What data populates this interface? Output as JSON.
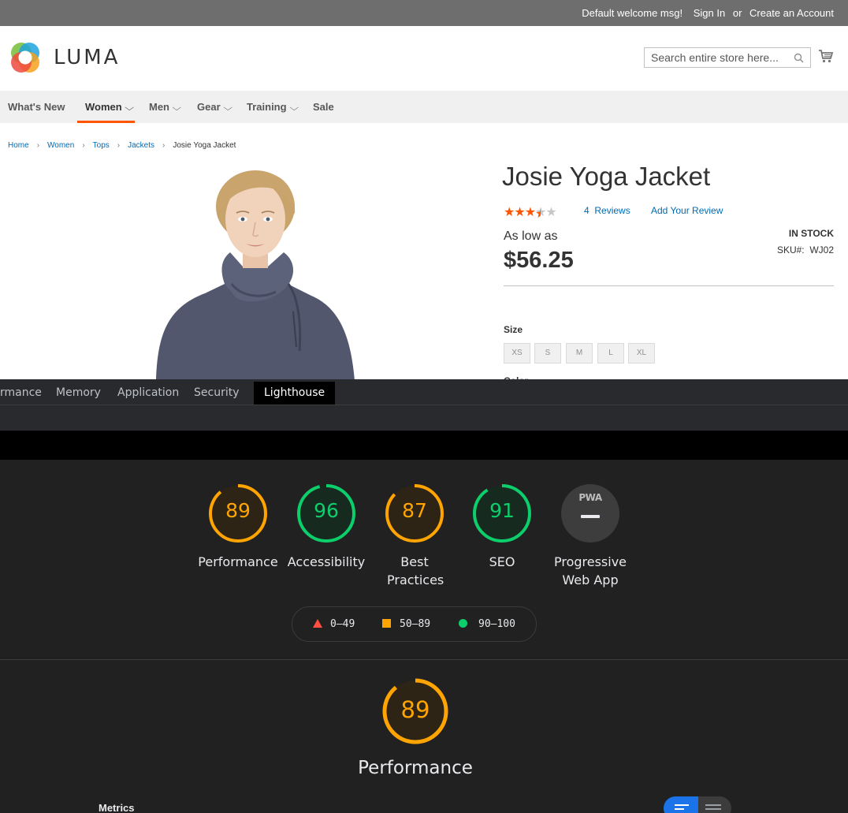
{
  "topbar": {
    "welcome": "Default welcome msg!",
    "sign_in": "Sign In",
    "or": "or",
    "create_account": "Create an Account"
  },
  "header": {
    "logo_text": "LUMA",
    "search_placeholder": "Search entire store here...",
    "icons": [
      "search-icon",
      "cart-icon"
    ]
  },
  "nav": {
    "items": [
      {
        "label": "What's New",
        "has_chevron": false
      },
      {
        "label": "Women",
        "has_chevron": true,
        "active": true
      },
      {
        "label": "Men",
        "has_chevron": true
      },
      {
        "label": "Gear",
        "has_chevron": true
      },
      {
        "label": "Training",
        "has_chevron": true
      },
      {
        "label": "Sale",
        "has_chevron": false
      }
    ],
    "active_color": "#ff5501"
  },
  "breadcrumbs": [
    "Home",
    "Women",
    "Tops",
    "Jackets",
    "Josie Yoga Jacket"
  ],
  "product": {
    "title": "Josie Yoga Jacket",
    "rating": 3.5,
    "rating_max": 5,
    "reviews_count": "4",
    "reviews_label": "Reviews",
    "add_review": "Add Your Review",
    "as_low_as": "As low as",
    "price": "$56.25",
    "stock": "IN STOCK",
    "sku_label": "SKU#:",
    "sku": "WJ02",
    "size_label": "Size",
    "sizes": [
      "XS",
      "S",
      "M",
      "L",
      "XL"
    ],
    "color_label": "Color"
  },
  "devtools": {
    "tabs": [
      {
        "label": "rmance"
      },
      {
        "label": "Memory"
      },
      {
        "label": "Application"
      },
      {
        "label": "Security"
      },
      {
        "label": "Lighthouse",
        "active": true
      }
    ],
    "categories": [
      {
        "label": "Performance",
        "score": "89",
        "color": "#ffa400"
      },
      {
        "label": "Accessibility",
        "score": "96",
        "color": "#0cce6b"
      },
      {
        "label": "Best Practices",
        "score": "87",
        "color": "#ffa400"
      },
      {
        "label": "SEO",
        "score": "91",
        "color": "#0cce6b"
      },
      {
        "label": "Progressive Web App",
        "badge": "PWA",
        "color": "#e8eaed"
      }
    ],
    "legend": [
      {
        "range": "0–49",
        "shape": "triangle",
        "color": "#ff4e42"
      },
      {
        "range": "50–89",
        "shape": "square",
        "color": "#ffa400"
      },
      {
        "range": "90–100",
        "shape": "circle",
        "color": "#0cce6b"
      }
    ],
    "focus": {
      "score": "89",
      "label": "Performance",
      "color": "#ffa400"
    },
    "metrics_label": "Metrics"
  }
}
